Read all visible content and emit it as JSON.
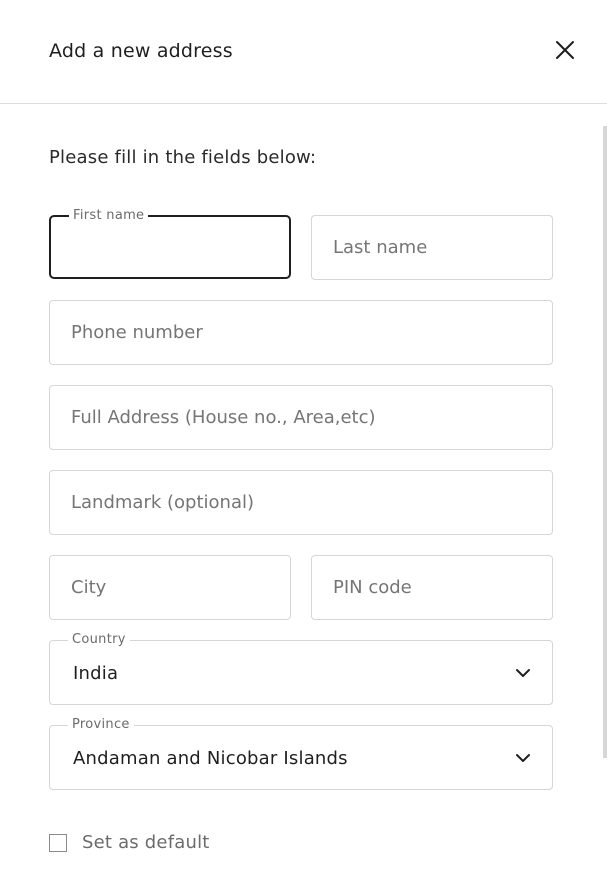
{
  "header": {
    "title": "Add a new address",
    "close_icon": "close-icon"
  },
  "form": {
    "instructions": "Please fill in the fields below:",
    "first_name": {
      "label": "First name",
      "value": "",
      "placeholder": ""
    },
    "last_name": {
      "placeholder": "Last name",
      "value": ""
    },
    "phone": {
      "placeholder": "Phone number",
      "value": ""
    },
    "address": {
      "placeholder": "Full Address (House no., Area,etc)",
      "value": ""
    },
    "landmark": {
      "placeholder": "Landmark (optional)",
      "value": ""
    },
    "city": {
      "placeholder": "City",
      "value": ""
    },
    "pin": {
      "placeholder": "PIN code",
      "value": ""
    },
    "country": {
      "label": "Country",
      "value": "India",
      "icon": "chevron-down-icon"
    },
    "province": {
      "label": "Province",
      "value": "Andaman and Nicobar Islands",
      "icon": "chevron-down-icon"
    },
    "default_checkbox": {
      "label": "Set as default",
      "checked": false
    }
  },
  "colors": {
    "text": "#1f1f1f",
    "muted": "#757575",
    "border": "#d6d6d6",
    "focus_border": "#1f1f1f"
  }
}
